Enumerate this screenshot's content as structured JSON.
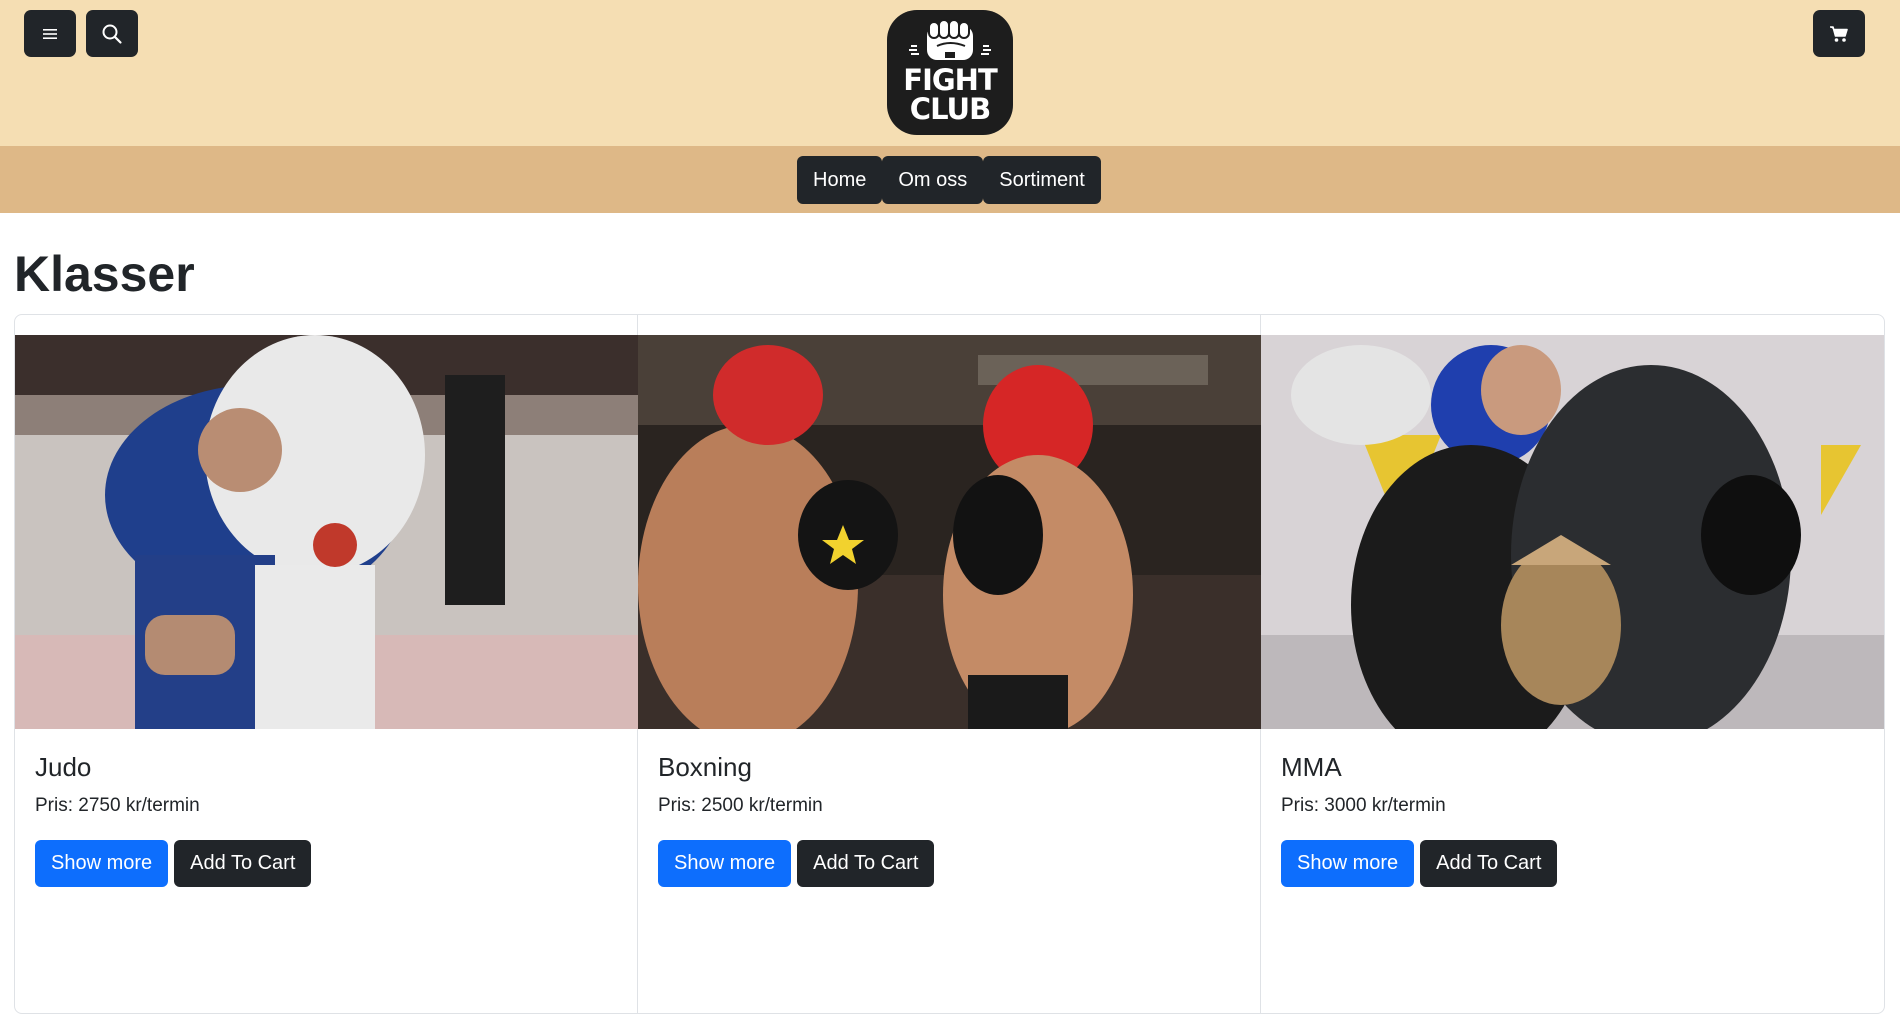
{
  "header": {
    "logo_text_line1": "FIGHT",
    "logo_text_line2": "CLUB",
    "menu_icon": "hamburger-icon",
    "search_icon": "search-icon",
    "cart_icon": "cart-icon"
  },
  "nav": {
    "items": [
      {
        "label": "Home"
      },
      {
        "label": "Om oss"
      },
      {
        "label": "Sortiment"
      }
    ]
  },
  "main": {
    "title": "Klasser",
    "cards": [
      {
        "title": "Judo",
        "price": "Pris: 2750 kr/termin",
        "show_more": "Show more",
        "add_to_cart": "Add To Cart"
      },
      {
        "title": "Boxning",
        "price": "Pris: 2500 kr/termin",
        "show_more": "Show more",
        "add_to_cart": "Add To Cart"
      },
      {
        "title": "MMA",
        "price": "Pris: 3000 kr/termin",
        "show_more": "Show more",
        "add_to_cart": "Add To Cart"
      }
    ]
  },
  "colors": {
    "header_bg": "#f5deb3",
    "nav_bg": "#deb887",
    "dark": "#212529",
    "primary": "#0d6efd"
  }
}
